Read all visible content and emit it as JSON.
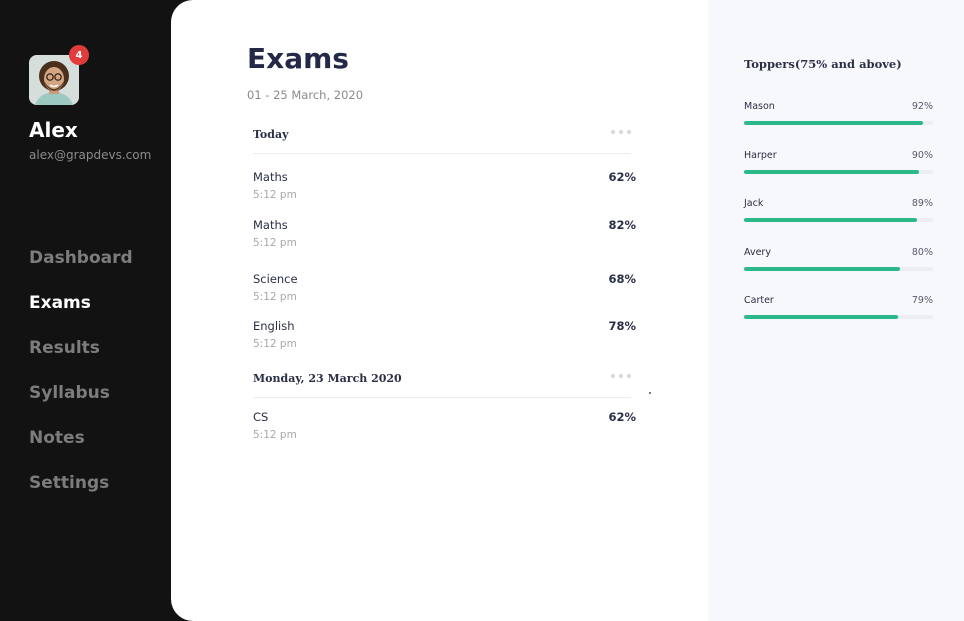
{
  "user": {
    "name": "Alex",
    "email": "alex@grapdevs.com",
    "notification_count": "4"
  },
  "nav": {
    "items": [
      {
        "label": "Dashboard",
        "active": false
      },
      {
        "label": "Exams",
        "active": true
      },
      {
        "label": "Results",
        "active": false
      },
      {
        "label": "Syllabus",
        "active": false
      },
      {
        "label": "Notes",
        "active": false
      },
      {
        "label": "Settings",
        "active": false
      }
    ]
  },
  "main": {
    "title": "Exams",
    "date_range": "01 - 25 March, 2020",
    "sections": [
      {
        "title": "Today",
        "exams": [
          {
            "subject": "Maths",
            "time": "5:12 pm",
            "score": "62%"
          },
          {
            "subject": "Maths",
            "time": "5:12 pm",
            "score": "82%"
          },
          {
            "subject": "Science",
            "time": "5:12 pm",
            "score": "68%"
          },
          {
            "subject": "English",
            "time": "5:12 pm",
            "score": "78%"
          }
        ]
      },
      {
        "title": "Monday, 23 March 2020",
        "exams": [
          {
            "subject": "CS",
            "time": "5:12 pm",
            "score": "62%"
          }
        ]
      }
    ]
  },
  "toppers": {
    "title": "Toppers(75% and above)",
    "items": [
      {
        "name": "Mason",
        "percent_label": "92%",
        "value": 92
      },
      {
        "name": "Harper",
        "percent_label": "90%",
        "value": 90
      },
      {
        "name": "Jack",
        "percent_label": "89%",
        "value": 89
      },
      {
        "name": "Avery",
        "percent_label": "80%",
        "value": 80
      },
      {
        "name": "Carter",
        "percent_label": "79%",
        "value": 79
      }
    ],
    "bar_color": "#2bb98a"
  },
  "colors": {
    "sidebar_bg": "#121212",
    "badge": "#e23b3b",
    "accent": "#2bb98a",
    "text_dark": "#232946"
  }
}
